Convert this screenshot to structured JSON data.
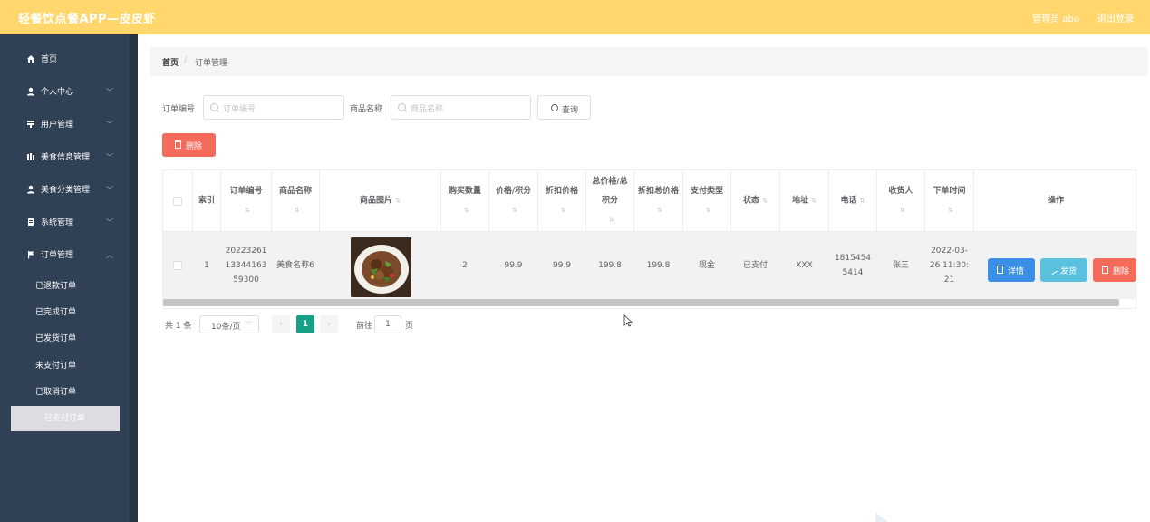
{
  "header": {
    "brand": "轻餐饮点餐APP—皮皮虾",
    "admin": "管理员 abo",
    "logout": "退出登录",
    "bg_color": "#ffd76c"
  },
  "sidebar": {
    "bg_color": "#304156",
    "menu": [
      {
        "icon": "home-icon",
        "label": "首页",
        "has_arrow": false
      },
      {
        "icon": "user-icon",
        "label": "个人中心",
        "has_arrow": true
      },
      {
        "icon": "users-icon",
        "label": "用户管理",
        "has_arrow": true
      },
      {
        "icon": "food-icon",
        "label": "美食信息管理",
        "has_arrow": true
      },
      {
        "icon": "category-icon",
        "label": "美食分类管理",
        "has_arrow": true
      },
      {
        "icon": "system-icon",
        "label": "系统管理",
        "has_arrow": true
      },
      {
        "icon": "flag-icon",
        "label": "订单管理",
        "has_arrow": true
      }
    ],
    "submenu": [
      {
        "label": "已退款订单",
        "active": false
      },
      {
        "label": "已完成订单",
        "active": false
      },
      {
        "label": "已发货订单",
        "active": false
      },
      {
        "label": "未支付订单",
        "active": false
      },
      {
        "label": "已取消订单",
        "active": false
      },
      {
        "label": "已支付订单",
        "active": true
      }
    ]
  },
  "breadcrumb": {
    "home": "首页",
    "separator": "/",
    "current": "订单管理"
  },
  "search": {
    "order_no_label": "订单编号",
    "order_no_placeholder": "订单编号",
    "order_no_value": "",
    "product_label": "商品名称",
    "product_placeholder": "商品名称",
    "product_value": "",
    "query_button": "查询"
  },
  "toolbar": {
    "delete_button": "删除",
    "delete_color": "#f46b5b"
  },
  "table": {
    "columns": [
      {
        "key": "checkbox",
        "label": "",
        "sortable": false
      },
      {
        "key": "index",
        "label": "索引",
        "sortable": false
      },
      {
        "key": "order_no",
        "label": "订单编号",
        "sortable": true
      },
      {
        "key": "product_name",
        "label": "商品名称",
        "sortable": true
      },
      {
        "key": "product_image",
        "label": "商品图片",
        "sortable": true
      },
      {
        "key": "quantity",
        "label": "购买数量",
        "sortable": true
      },
      {
        "key": "price",
        "label": "价格/积分",
        "sortable": true
      },
      {
        "key": "discount_price",
        "label": "折扣价格",
        "sortable": true
      },
      {
        "key": "total",
        "label": "总价格/总积分",
        "sortable": true
      },
      {
        "key": "discount_total",
        "label": "折扣总价格",
        "sortable": true
      },
      {
        "key": "pay_type",
        "label": "支付类型",
        "sortable": true
      },
      {
        "key": "status",
        "label": "状态",
        "sortable": true
      },
      {
        "key": "address",
        "label": "地址",
        "sortable": true
      },
      {
        "key": "phone",
        "label": "电话",
        "sortable": true
      },
      {
        "key": "receiver",
        "label": "收货人",
        "sortable": true
      },
      {
        "key": "order_time",
        "label": "下单时间",
        "sortable": true
      },
      {
        "key": "actions",
        "label": "操作",
        "sortable": false
      }
    ],
    "rows": [
      {
        "index": "1",
        "order_no": "202232611334416359300",
        "product_name": "美食名称6",
        "quantity": "2",
        "price": "99.9",
        "discount_price": "99.9",
        "total": "199.8",
        "discount_total": "199.8",
        "pay_type": "现金",
        "status": "已支付",
        "address": "XXX",
        "phone": "18154545414",
        "receiver": "张三",
        "order_time": "2022-03-26 11:30:21"
      }
    ],
    "actions": {
      "detail": "详情",
      "ship": "发货",
      "delete": "删除",
      "detail_color": "#3a8ee6",
      "ship_color": "#5bc0de",
      "delete_color": "#f46b5b"
    }
  },
  "pagination": {
    "total": "共 1 条",
    "page_size": "10条/页",
    "current_page": "1",
    "goto_label": "前往",
    "goto_value": "1",
    "page_suffix": "页",
    "active_color": "#16a085"
  }
}
